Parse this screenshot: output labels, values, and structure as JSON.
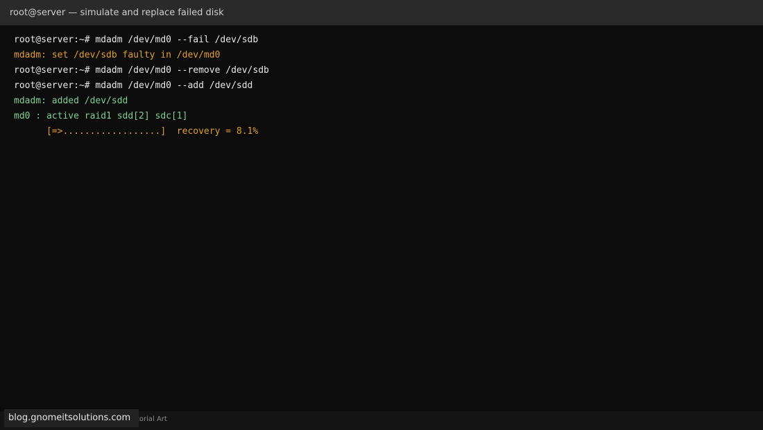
{
  "window": {
    "title": "root@server — simulate and replace failed disk"
  },
  "terminal": {
    "lines": [
      {
        "text": "root@server:~# mdadm /dev/md0 --fail /dev/sdb",
        "color": "#e8e8e8"
      },
      {
        "text": "mdadm: set /dev/sdb faulty in /dev/md0",
        "color": "#e0a030"
      },
      {
        "text": "root@server:~# mdadm /dev/md0 --remove /dev/sdb",
        "color": "#e8e8e8"
      },
      {
        "text": "root@server:~# mdadm /dev/md0 --add /dev/sdd",
        "color": "#e8e8e8"
      },
      {
        "text": "mdadm: added /dev/sdd",
        "color": "#7fcf98"
      },
      {
        "text": "md0 : active raid1 sdd[2] sdc[1]",
        "color": "#7fcf98"
      },
      {
        "text": "      [=>..................]  recovery = 8.1%",
        "color": "#e0a030"
      }
    ],
    "recovery_percent": 8.1
  },
  "footer": {
    "caption": "Tutorial Art"
  },
  "watermark": {
    "text": "blog.gnomeitsolutions.com"
  }
}
